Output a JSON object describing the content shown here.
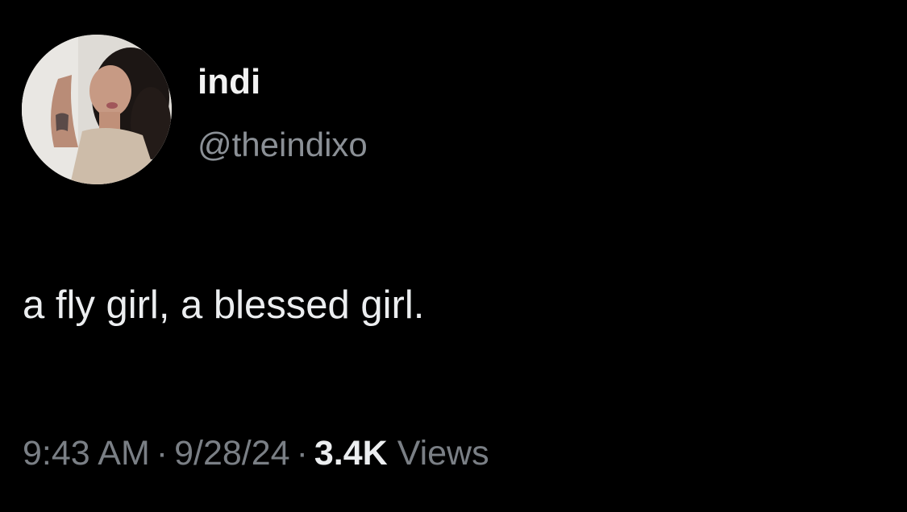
{
  "author": {
    "display_name": "indi",
    "handle": "@theindixo",
    "avatar_icon": "user-avatar-photo"
  },
  "tweet": {
    "text": "a fly girl, a blessed girl."
  },
  "meta": {
    "time": "9:43 AM",
    "separator": "·",
    "date": "9/28/24",
    "views_count": "3.4K",
    "views_label": "Views"
  },
  "colors": {
    "background": "#000000",
    "primary_text": "#eceef0",
    "secondary_text": "#7a7f85"
  }
}
